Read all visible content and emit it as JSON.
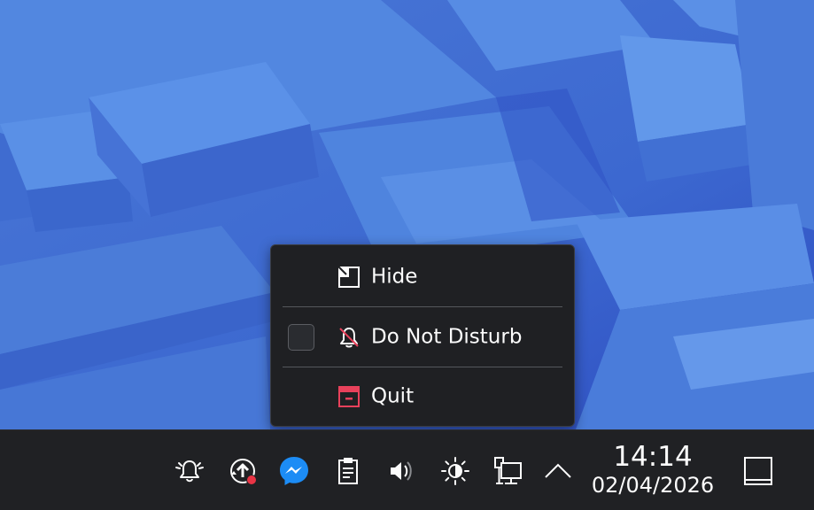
{
  "menu": {
    "items": [
      {
        "label": "Hide",
        "icon": "hide-window-icon"
      },
      {
        "label": "Do Not Disturb",
        "icon": "bell-off-icon",
        "checked": false
      },
      {
        "label": "Quit",
        "icon": "quit-application-icon"
      }
    ]
  },
  "tray": {
    "icons": [
      "notifications-bell-icon",
      "update-available-icon",
      "messenger-icon",
      "clipboard-icon",
      "volume-icon",
      "brightness-icon",
      "network-icon",
      "show-hidden-icons-chevron-icon"
    ]
  },
  "clock": {
    "time": "14:14",
    "date": "02/04/2026"
  },
  "colors": {
    "panel": "#202124",
    "menu_bg": "#1f2023",
    "text": "#fcfcfc",
    "quit_red": "#e8415b",
    "badge_red": "#e93445",
    "messenger_blue": "#1c8cf5",
    "wallpaper_blue": "#4f7fd9"
  }
}
